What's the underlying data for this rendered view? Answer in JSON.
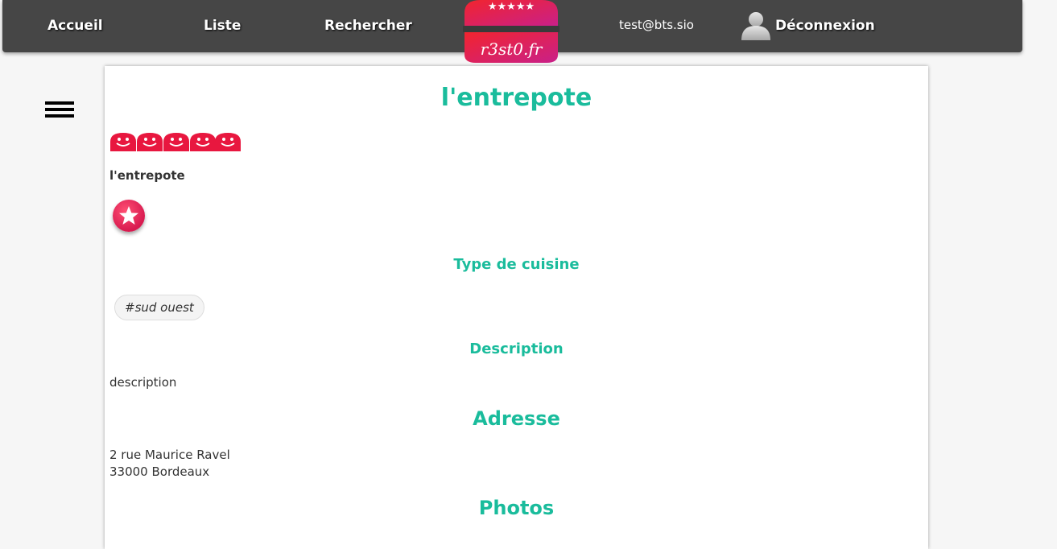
{
  "nav": {
    "home": "Accueil",
    "list": "Liste",
    "search": "Rechercher",
    "email": "test@bts.sio",
    "logout": "Déconnexion"
  },
  "logo": {
    "text": "r3st0.fr"
  },
  "restaurant": {
    "title": "l'entrepote",
    "name": "l'entrepote",
    "rating_smileys": 5,
    "sections": {
      "cuisine": "Type de cuisine",
      "description": "Description",
      "address": "Adresse",
      "photos": "Photos"
    },
    "cuisine_tag": "#sud ouest",
    "description": "description",
    "address_line1": "2 rue Maurice Ravel",
    "address_line2": "33000 Bordeaux"
  },
  "colors": {
    "accent": "#1abc9c",
    "navbar": "#464646",
    "brand_red": "#e8173f",
    "brand_pink": "#d01f7c"
  },
  "icons": [
    "burger-logo-icon",
    "user-avatar-icon",
    "hamburger-menu-icon",
    "smiley-rating-icon",
    "star-favorite-icon"
  ]
}
